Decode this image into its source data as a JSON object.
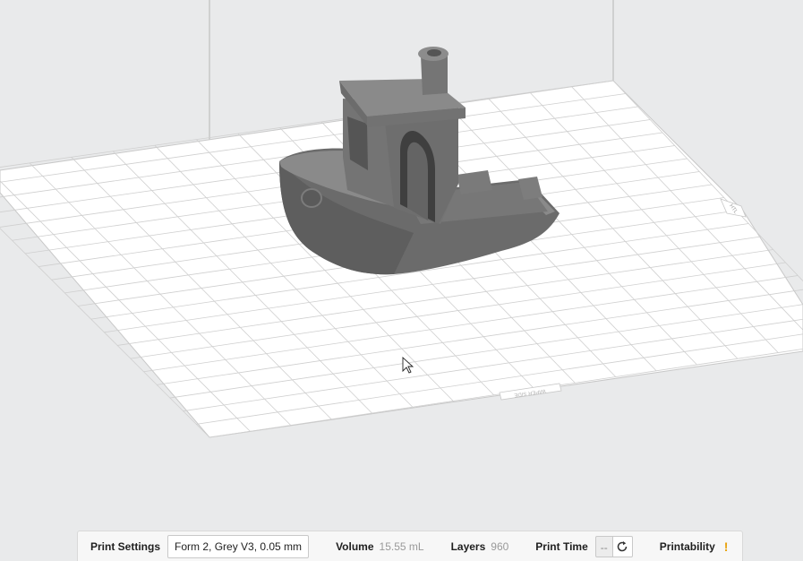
{
  "viewport": {
    "plate_front_label": "WIPER SIDE",
    "plate_side_label": "HTL"
  },
  "status_bar": {
    "print_settings_label": "Print Settings",
    "print_settings_value": "Form 2, Grey V3, 0.05 mm",
    "volume_label": "Volume",
    "volume_value": "15.55 mL",
    "layers_label": "Layers",
    "layers_value": "960",
    "print_time_label": "Print Time",
    "print_time_value": "--",
    "printability_label": "Printability",
    "printability_status": "!",
    "refresh_icon": "refresh-icon",
    "warning_color": "#e8a20c"
  }
}
